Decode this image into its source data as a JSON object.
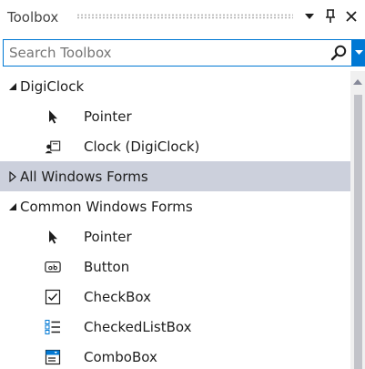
{
  "window": {
    "title": "Toolbox",
    "dropdown_icon": "triangle-down",
    "pin_icon": "pin",
    "close_icon": "close-x"
  },
  "search": {
    "value": "",
    "placeholder": "Search Toolbox",
    "icon": "search-magnifier",
    "dropdown_icon": "triangle-down"
  },
  "groups": [
    {
      "label": "DigiClock",
      "expanded": true,
      "items": [
        {
          "label": "Pointer",
          "icon": "pointer-arrow"
        },
        {
          "label": "Clock (DigiClock)",
          "icon": "user-control"
        }
      ]
    },
    {
      "label": "All Windows Forms",
      "expanded": false,
      "highlighted": true,
      "items": []
    },
    {
      "label": "Common Windows Forms",
      "expanded": true,
      "items": [
        {
          "label": "Pointer",
          "icon": "pointer-arrow"
        },
        {
          "label": "Button",
          "icon": "button-ab"
        },
        {
          "label": "CheckBox",
          "icon": "checkbox"
        },
        {
          "label": "CheckedListBox",
          "icon": "checked-list"
        },
        {
          "label": "ComboBox",
          "icon": "combobox"
        }
      ]
    }
  ],
  "colors": {
    "accent": "#0078d4",
    "highlight": "#ccd0dc",
    "scroll_thumb": "#c2c3c9",
    "scroll_track": "#f0f0f0"
  }
}
